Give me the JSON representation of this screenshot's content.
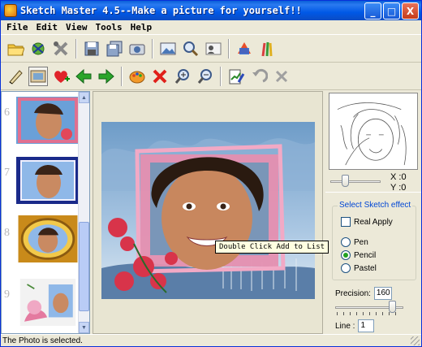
{
  "window": {
    "title": "Sketch Master 4.5--Make a picture for yourself!!",
    "minimize": "_",
    "maximize": "□",
    "close": "X"
  },
  "menu": [
    "File",
    "Edit",
    "View",
    "Tools",
    "Help"
  ],
  "thumbnails": [
    {
      "number": "6"
    },
    {
      "number": "7"
    },
    {
      "number": "8"
    },
    {
      "number": "9"
    }
  ],
  "canvas": {
    "tooltip": "Double Click Add to  List"
  },
  "preview": {
    "x_label": "X :",
    "x_value": "0",
    "y_label": "Y :",
    "y_value": "0"
  },
  "effect": {
    "group_title": "Select Sketch effect",
    "real_apply": "Real Apply",
    "real_apply_checked": false,
    "options": [
      "Pen",
      "Pencil",
      "Pastel"
    ],
    "selected": "Pencil",
    "precision_label": "Precision:",
    "precision_value": "160",
    "line_label": "Line :",
    "line_value": "1"
  },
  "status": {
    "text": "The Photo is selected."
  },
  "colors": {
    "title_bar": "#0058e6",
    "window_bg": "#ece9d8",
    "frame_pink": "#e58fb0",
    "group_title": "#0046d5"
  },
  "icons": {
    "toolbar1": [
      "open-folder-icon",
      "scan-icon",
      "tools-icon",
      "save-icon",
      "save-all-icon",
      "camera-icon",
      "image-icon",
      "zoom-icon",
      "id-card-icon",
      "shapes-icon",
      "brushes-icon"
    ],
    "toolbar2": [
      "pen-icon",
      "photo-icon",
      "add-favorite-icon",
      "back-arrow-icon",
      "forward-arrow-icon",
      "palette-icon",
      "delete-icon",
      "zoom-in-icon",
      "zoom-out-icon",
      "edit-doc-icon",
      "undo-icon",
      "cancel-icon"
    ]
  }
}
